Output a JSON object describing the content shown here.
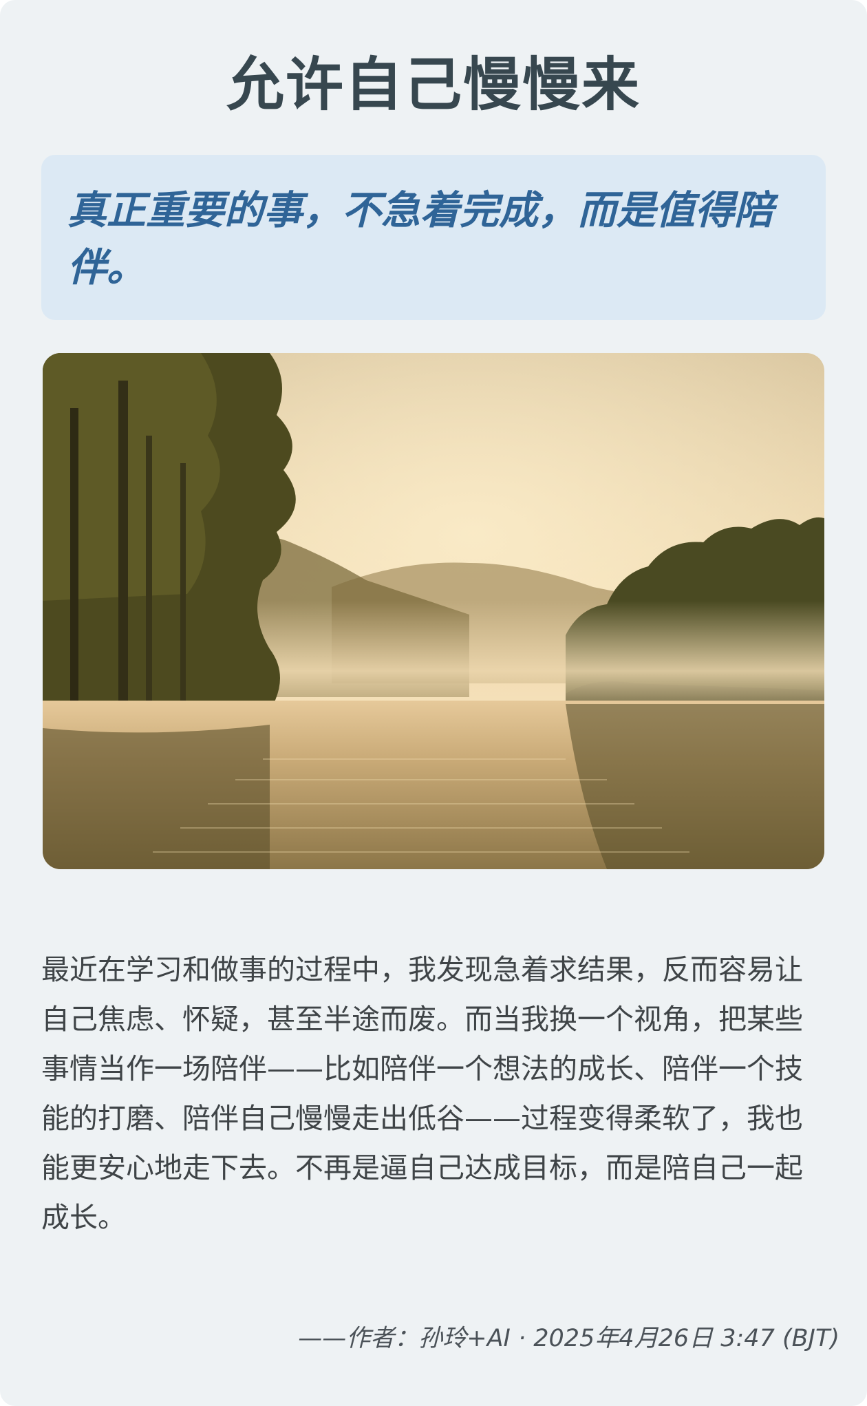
{
  "article": {
    "title": "允许自己慢慢来",
    "quote": "真正重要的事，不急着完成，而是值得陪伴。",
    "body": "最近在学习和做事的过程中，我发现急着求结果，反而容易让自己焦虑、怀疑，甚至半途而废。而当我换一个视角，把某些事情当作一场陪伴——比如陪伴一个想法的成长、陪伴一个技能的打磨、陪伴自己慢慢走出低谷——过程变得柔软了，我也能更安心地走下去。不再是逼自己达成目标，而是陪自己一起成长。",
    "signature": "——作者：孙玲+AI · 2025年4月26日 3:47 (BJT)"
  },
  "colors": {
    "page_background": "#eef2f4",
    "title": "#37474f",
    "quote_background": "#dce9f4",
    "quote_text": "#2f6497",
    "body_text": "#3f4447"
  },
  "photo": {
    "subject": "misty lake at sunrise with forested hills and tall trees"
  }
}
